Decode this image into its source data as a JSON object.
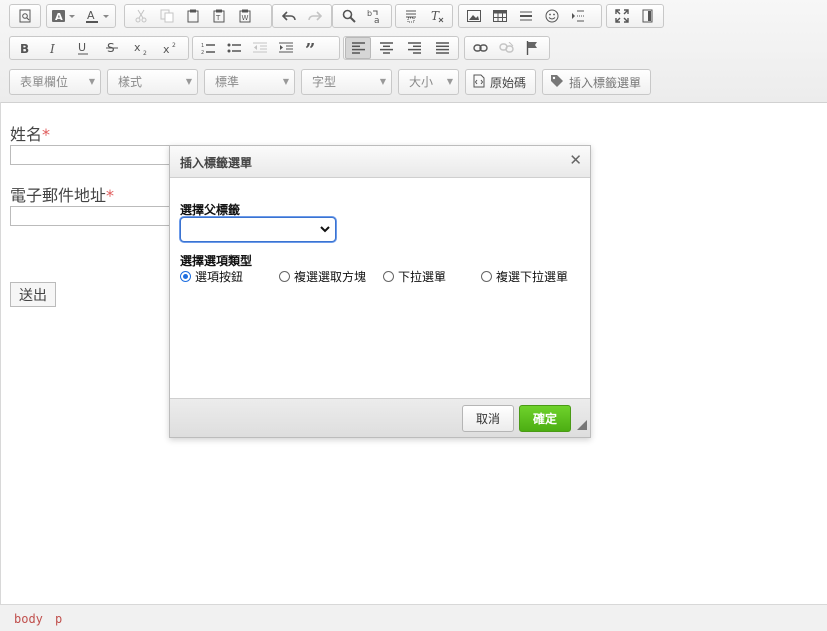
{
  "toolbar": {
    "row3": {
      "form_field_combo": "表單欄位",
      "style_combo": "樣式",
      "format_combo": "標準",
      "font_combo": "字型",
      "size_combo": "大小",
      "source_button": "原始碼",
      "insert_tag_button": "插入標籤選單"
    }
  },
  "form": {
    "name_label": "姓名",
    "email_label": "電子郵件地址",
    "required_mark": "*",
    "submit_label": "送出"
  },
  "dialog": {
    "title": "插入標籤選單",
    "close_glyph": "✕",
    "parent_label": "選擇父標籤",
    "parent_select_value": "",
    "type_label": "選擇選項類型",
    "options": [
      {
        "label": "選項按鈕",
        "checked": true
      },
      {
        "label": "複選選取方塊",
        "checked": false
      },
      {
        "label": "下拉選單",
        "checked": false
      },
      {
        "label": "複選下拉選單",
        "checked": false
      }
    ],
    "cancel_label": "取消",
    "ok_label": "確定"
  },
  "statusbar": {
    "path": [
      "body",
      "p"
    ]
  },
  "colors": {
    "ok_button": "#5bbf1c",
    "required": "#e05a5a",
    "path_text": "#c0504d",
    "radio_selected": "#1f6fe0"
  }
}
